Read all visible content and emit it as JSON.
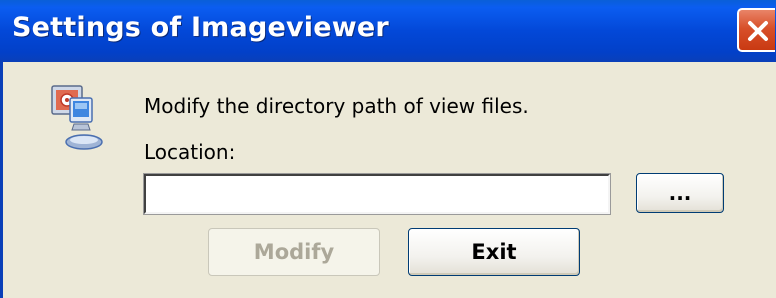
{
  "window": {
    "title": "Settings of Imageviewer"
  },
  "dialog": {
    "icon": "monitor-settings-icon",
    "message": "Modify the directory path of view files.",
    "location_label": "Location:",
    "location_value": "",
    "browse_label": "...",
    "modify_label": "Modify",
    "exit_label": "Exit"
  },
  "colors": {
    "titlebar": "#0348d8",
    "dialog_bg": "#ece9d8",
    "close_button": "#d8502a",
    "disabled_text": "#aca899"
  }
}
